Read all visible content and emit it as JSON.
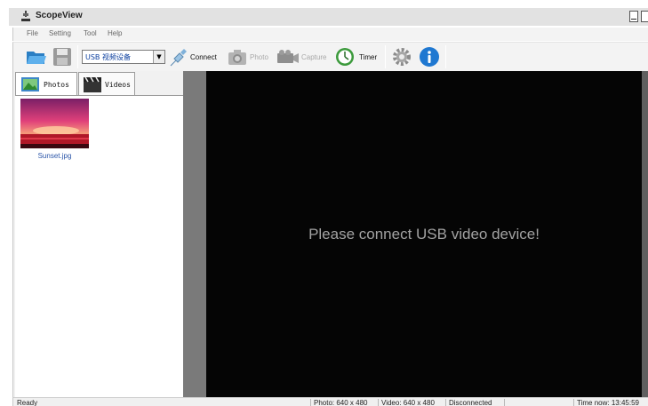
{
  "window": {
    "title": "ScopeView",
    "minimize_label": "_"
  },
  "menu": [
    {
      "label": "File"
    },
    {
      "label": "Setting"
    },
    {
      "label": "Tool"
    },
    {
      "label": "Help"
    }
  ],
  "toolbar": {
    "device_value": "USB 视频设备",
    "dropdown_arrow": "▼",
    "connect_label": "Connect",
    "photo_label": "Photo",
    "capture_label": "Capture",
    "timer_label": "Timer",
    "icons": [
      "folder-open-icon",
      "save-icon",
      "usb-plug-icon",
      "camera-icon",
      "video-camera-icon",
      "timer-icon",
      "settings-gear-icon",
      "info-icon"
    ],
    "disabled": [
      "Photo",
      "Capture"
    ]
  },
  "tabs": [
    {
      "label": "Photos",
      "active": true
    },
    {
      "label": "Videos",
      "active": false
    }
  ],
  "files": [
    {
      "name": "Sunset.jpg"
    }
  ],
  "video": {
    "message": "Please connect USB video device!"
  },
  "status": {
    "ready": "Ready",
    "photo": "Photo: 640 x 480",
    "video": "Video: 640 x 480",
    "connection": "Disconnected",
    "time": "Time now: 13:45:59"
  },
  "colors": {
    "video_background": "#050505",
    "message_text": "#a2a2a2",
    "info_blue": "#1f78d1",
    "timer_green": "#3c9a3c"
  }
}
